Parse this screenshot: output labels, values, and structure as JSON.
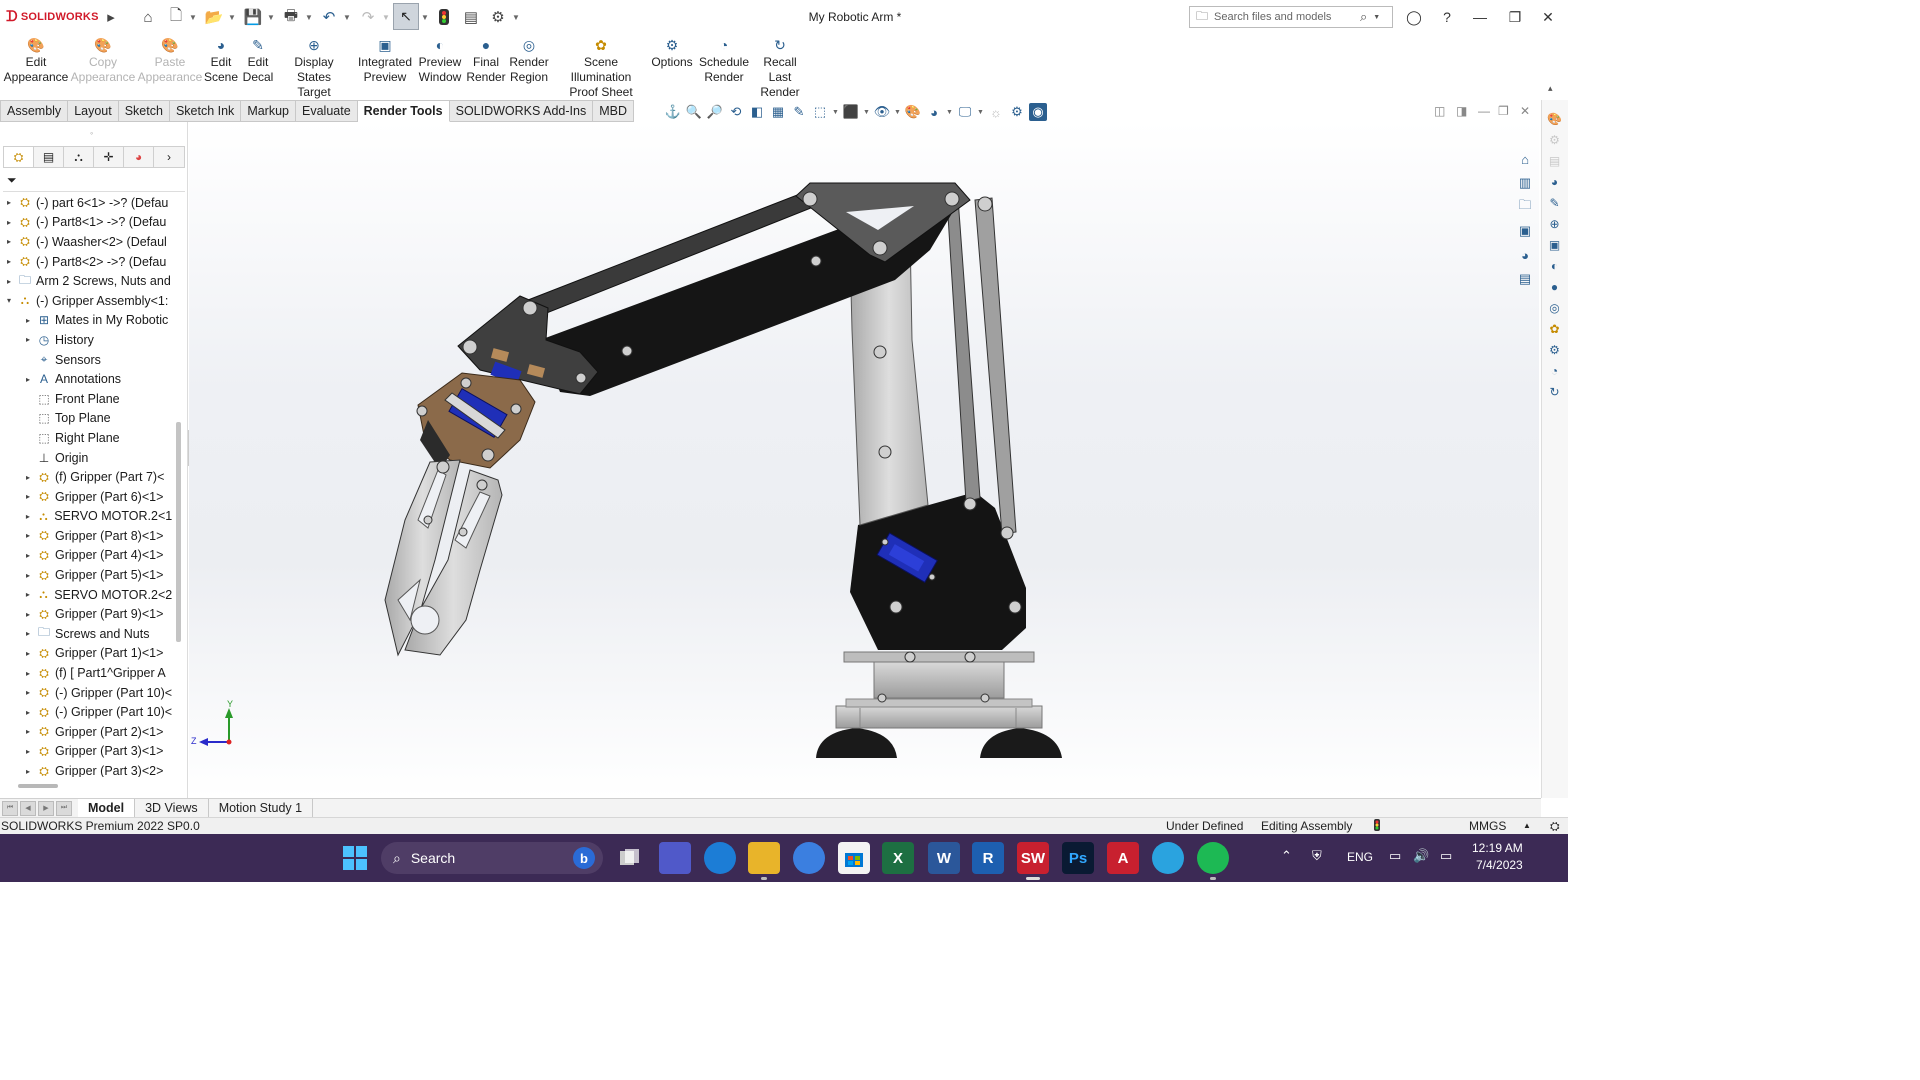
{
  "app": {
    "logo_text": "SOLIDWORKS",
    "document_title": "My Robotic Arm *"
  },
  "search": {
    "placeholder": "Search files and models"
  },
  "ribbon": [
    {
      "line1": "Edit",
      "line2": "Appearance",
      "icon": "edit-appearance-icon",
      "enabled": true
    },
    {
      "line1": "Copy",
      "line2": "Appearance",
      "icon": "copy-appearance-icon",
      "enabled": false
    },
    {
      "line1": "Paste",
      "line2": "Appearance",
      "icon": "paste-appearance-icon",
      "enabled": false
    },
    {
      "line1": "Edit",
      "line2": "Scene",
      "icon": "edit-scene-icon",
      "enabled": true
    },
    {
      "line1": "Edit",
      "line2": "Decal",
      "icon": "edit-decal-icon",
      "enabled": true
    },
    {
      "line1": "Display States",
      "line2": "Target",
      "icon": "display-states-icon",
      "enabled": true
    },
    {
      "line1": "Integrated",
      "line2": "Preview",
      "icon": "integrated-preview-icon",
      "enabled": true
    },
    {
      "line1": "Preview",
      "line2": "Window",
      "icon": "preview-window-icon",
      "enabled": true
    },
    {
      "line1": "Final",
      "line2": "Render",
      "icon": "final-render-icon",
      "enabled": true
    },
    {
      "line1": "Render",
      "line2": "Region",
      "icon": "render-region-icon",
      "enabled": true
    },
    {
      "line1": "Scene Illumination",
      "line2": "Proof Sheet",
      "icon": "scene-illumination-icon",
      "enabled": true
    },
    {
      "line1": "Options",
      "line2": "",
      "icon": "options-icon",
      "enabled": true
    },
    {
      "line1": "Schedule",
      "line2": "Render",
      "icon": "schedule-render-icon",
      "enabled": true
    },
    {
      "line1": "Recall Last",
      "line2": "Render",
      "icon": "recall-last-render-icon",
      "enabled": true
    }
  ],
  "tabs": [
    "Assembly",
    "Layout",
    "Sketch",
    "Sketch Ink",
    "Markup",
    "Evaluate",
    "Render Tools",
    "SOLIDWORKS Add-Ins",
    "MBD"
  ],
  "active_tab": "Render Tools",
  "tree": [
    {
      "label": "(-) part 6<1> ->? (Defau",
      "icon": "part-icon",
      "indent": 0,
      "expand": "collapsed"
    },
    {
      "label": "(-) Part8<1> ->? (Defau",
      "icon": "part-icon",
      "indent": 0,
      "expand": "collapsed"
    },
    {
      "label": "(-) Waasher<2> (Defaul",
      "icon": "part-icon",
      "indent": 0,
      "expand": "collapsed"
    },
    {
      "label": "(-) Part8<2> ->? (Defau",
      "icon": "part-icon",
      "indent": 0,
      "expand": "collapsed"
    },
    {
      "label": "Arm 2 Screws, Nuts and",
      "icon": "folder-icon",
      "indent": 0,
      "expand": "collapsed"
    },
    {
      "label": "(-) Gripper Assembly<1:",
      "icon": "assembly-icon",
      "indent": 0,
      "expand": "expanded"
    },
    {
      "label": "Mates in My Robotic",
      "icon": "mates-icon",
      "indent": 1,
      "expand": "collapsed"
    },
    {
      "label": "History",
      "icon": "history-icon",
      "indent": 1,
      "expand": "collapsed"
    },
    {
      "label": "Sensors",
      "icon": "sensors-icon",
      "indent": 1,
      "expand": "none"
    },
    {
      "label": "Annotations",
      "icon": "annotations-icon",
      "indent": 1,
      "expand": "collapsed"
    },
    {
      "label": "Front Plane",
      "icon": "plane-icon",
      "indent": 1,
      "expand": "none"
    },
    {
      "label": "Top Plane",
      "icon": "plane-icon",
      "indent": 1,
      "expand": "none"
    },
    {
      "label": "Right Plane",
      "icon": "plane-icon",
      "indent": 1,
      "expand": "none"
    },
    {
      "label": "Origin",
      "icon": "origin-icon",
      "indent": 1,
      "expand": "none"
    },
    {
      "label": "(f) Gripper (Part 7)<",
      "icon": "part-icon",
      "indent": 1,
      "expand": "collapsed"
    },
    {
      "label": "Gripper (Part 6)<1>",
      "icon": "part-icon",
      "indent": 1,
      "expand": "collapsed"
    },
    {
      "label": "SERVO MOTOR.2<1:",
      "icon": "assembly-icon",
      "indent": 1,
      "expand": "collapsed"
    },
    {
      "label": "Gripper (Part 8)<1>",
      "icon": "part-icon",
      "indent": 1,
      "expand": "collapsed"
    },
    {
      "label": "Gripper (Part 4)<1>",
      "icon": "part-icon",
      "indent": 1,
      "expand": "collapsed"
    },
    {
      "label": "Gripper (Part 5)<1>",
      "icon": "part-icon",
      "indent": 1,
      "expand": "collapsed"
    },
    {
      "label": "SERVO MOTOR.2<2:",
      "icon": "assembly-icon",
      "indent": 1,
      "expand": "collapsed"
    },
    {
      "label": "Gripper (Part 9)<1>",
      "icon": "part-icon",
      "indent": 1,
      "expand": "collapsed"
    },
    {
      "label": "Screws and Nuts",
      "icon": "folder-icon",
      "indent": 1,
      "expand": "collapsed"
    },
    {
      "label": "Gripper (Part 1)<1>",
      "icon": "part-icon",
      "indent": 1,
      "expand": "collapsed"
    },
    {
      "label": "(f) [ Part1^Gripper A",
      "icon": "part-icon",
      "indent": 1,
      "expand": "collapsed"
    },
    {
      "label": "(-) Gripper (Part 10)<",
      "icon": "part-icon",
      "indent": 1,
      "expand": "collapsed"
    },
    {
      "label": "(-) Gripper (Part 10)<",
      "icon": "part-icon",
      "indent": 1,
      "expand": "collapsed"
    },
    {
      "label": "Gripper (Part 2)<1>",
      "icon": "part-icon",
      "indent": 1,
      "expand": "collapsed"
    },
    {
      "label": "Gripper (Part 3)<1>",
      "icon": "part-icon",
      "indent": 1,
      "expand": "collapsed"
    },
    {
      "label": "Gripper (Part 3)<2>",
      "icon": "part-icon",
      "indent": 1,
      "expand": "collapsed"
    }
  ],
  "triad": {
    "y_label": "Y",
    "z_label": "Z"
  },
  "bottom_tabs": [
    "Model",
    "3D Views",
    "Motion Study 1"
  ],
  "active_bottom_tab": "Model",
  "status": {
    "version": "SOLIDWORKS Premium 2022 SP0.0",
    "definition": "Under Defined",
    "mode": "Editing Assembly",
    "units": "MMGS"
  },
  "taskbar": {
    "search_label": "Search",
    "language": "ENG",
    "time": "12:19 AM",
    "date": "7/4/2023",
    "apps": [
      {
        "icon": "windows-start-icon",
        "glyph": ""
      },
      {
        "icon": "bing-icon",
        "glyph": "b"
      },
      {
        "icon": "task-view-icon",
        "glyph": ""
      },
      {
        "icon": "teams-icon",
        "glyph": ""
      },
      {
        "icon": "edge-icon",
        "glyph": ""
      },
      {
        "icon": "file-explorer-icon",
        "glyph": ""
      },
      {
        "icon": "copilot-icon",
        "glyph": ""
      },
      {
        "icon": "microsoft-store-icon",
        "glyph": ""
      },
      {
        "icon": "excel-icon",
        "glyph": "X"
      },
      {
        "icon": "word-icon",
        "glyph": "W"
      },
      {
        "icon": "revit-icon",
        "glyph": "R"
      },
      {
        "icon": "solidworks-icon",
        "glyph": "SW"
      },
      {
        "icon": "photoshop-icon",
        "glyph": "Ps"
      },
      {
        "icon": "autocad-icon",
        "glyph": "A"
      },
      {
        "icon": "telegram-icon",
        "glyph": ""
      },
      {
        "icon": "spotify-icon",
        "glyph": ""
      }
    ]
  },
  "colors": {
    "accent_red": "#d11a2a",
    "taskbar": "#3c2a55",
    "robot_black": "#141414",
    "robot_grey": "#c9c9c9",
    "servo_blue": "#1f2fb8"
  }
}
